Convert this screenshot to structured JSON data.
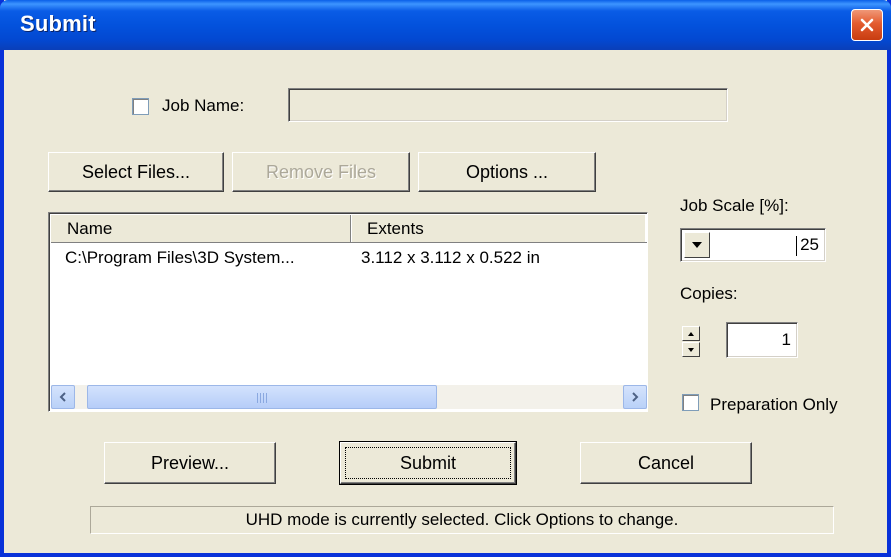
{
  "window": {
    "title": "Submit"
  },
  "job_name": {
    "label": "Job Name:",
    "checked": false,
    "value": ""
  },
  "toolbar": {
    "select_files": "Select Files...",
    "remove_files": "Remove Files",
    "options": "Options ..."
  },
  "file_list": {
    "columns": [
      "Name",
      "Extents"
    ],
    "rows": [
      {
        "name": "C:\\Program Files\\3D System...",
        "extents": "3.112 x 3.112 x 0.522 in"
      }
    ],
    "scrollbar_grip": "III"
  },
  "job_scale": {
    "label": "Job Scale [%]:",
    "value": "25"
  },
  "copies": {
    "label": "Copies:",
    "value": "1"
  },
  "preparation_only": {
    "label": "Preparation Only",
    "checked": false
  },
  "buttons": {
    "preview": "Preview...",
    "submit": "Submit",
    "cancel": "Cancel"
  },
  "status": {
    "message": "UHD mode is currently selected. Click Options to change."
  },
  "colors": {
    "titlebar": "#0352dd",
    "window_bg": "#ece9d8",
    "close_button": "#e35c2f"
  },
  "icons": {
    "close": "close-icon",
    "combo_dropdown": "chevron-down-icon",
    "spin_up": "triangle-up-icon",
    "spin_down": "triangle-down-icon",
    "scroll_left": "chevron-left-icon",
    "scroll_right": "chevron-right-icon"
  }
}
